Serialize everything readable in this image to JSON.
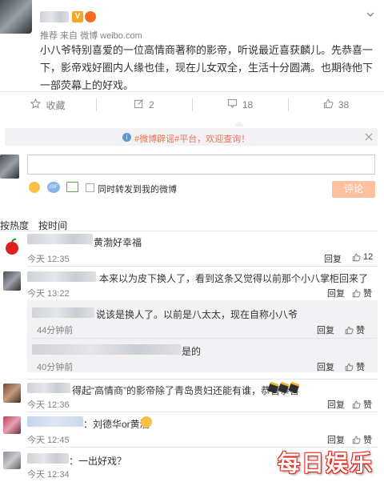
{
  "post": {
    "source": "推荐 来自 微博 weibo.com",
    "content": "小八爷特别喜爱的一位高情商著称的影帝，听说最近喜获麟儿。先恭喜一下，影帝戏好圈内人缘也佳，现在儿女双全，生活十分圆满。也期待他下一部荧幕上的好戏。"
  },
  "actions": {
    "favorite": "收藏",
    "repost_count": "2",
    "comment_count": "18",
    "like_count": "38"
  },
  "notice": "#微博辟谣#平台，欢迎查询！",
  "composer": {
    "placeholder": "",
    "repost_label": "同时转发到我的微博",
    "submit": "评论"
  },
  "sort": {
    "hot": "按热度",
    "time": "按时间"
  },
  "comments": [
    {
      "text": "黄渤好幸福",
      "time": "今天 12:35",
      "reply": "回复",
      "likes": "12"
    },
    {
      "text": "本来以为皮下换人了，看到这条又觉得以前那个小八掌柜回来了",
      "time": "今天 13:22",
      "reply": "回复",
      "likes": "赞",
      "replies": [
        {
          "text": "说该是换人了。以前是八太太，现在自称小八爷",
          "time": "44分钟前",
          "reply": "回复",
          "likes": "赞"
        },
        {
          "text": "是的",
          "time": "40分钟前",
          "reply": "回复",
          "likes": "赞"
        }
      ]
    },
    {
      "text": "得起“高情商”的影帝除了青岛贵妇还能有谁，恭喜恭喜",
      "time": "今天 12:36",
      "reply": "回复",
      "likes": "赞"
    },
    {
      "text": "：刘德华or黄渤",
      "time": "今天 12:45",
      "reply": "回复",
      "likes": "赞"
    },
    {
      "text": "：一出好戏？",
      "time": "今天 12:34",
      "reply": "回复",
      "likes": "赞"
    }
  ],
  "watermark": "每日娱乐",
  "colors": {
    "accent": "#eb7350",
    "notice_bg": "#f2f2f5",
    "submit_bg": "#ffc09f"
  }
}
